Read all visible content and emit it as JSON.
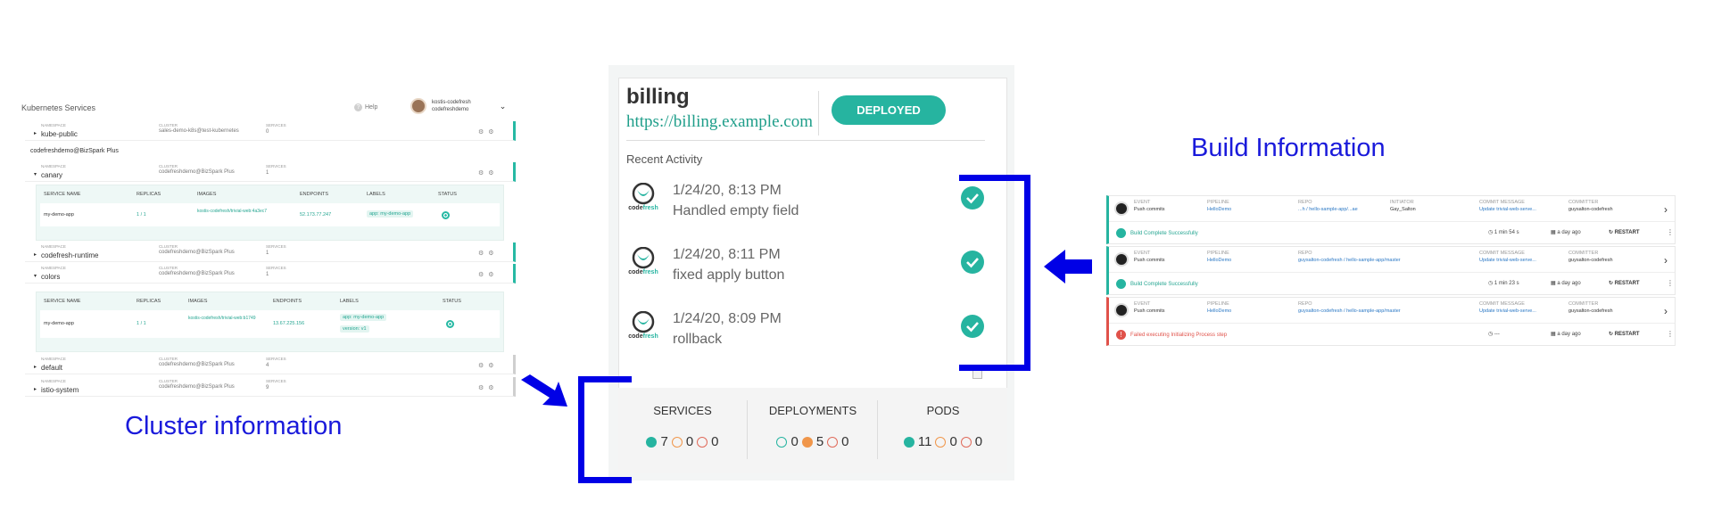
{
  "k8s": {
    "title": "Kubernetes Services",
    "help": "Help",
    "user_name": "kostis-codefresh",
    "user_account": "codefreshdemo",
    "cap_namespace": "NAMESPACE",
    "cap_cluster": "CLUSTER",
    "cap_services": "SERVICES",
    "rows": [
      {
        "ns": "kube-public",
        "cluster": "sales-demo-k8s@test-kubernetes",
        "services": "0"
      },
      {
        "ns": "canary",
        "cluster": "codefreshdemo@BizSpark Plus",
        "services": "1"
      },
      {
        "ns": "codefresh-runtime",
        "cluster": "codefreshdemo@BizSpark Plus",
        "services": "1"
      },
      {
        "ns": "colors",
        "cluster": "codefreshdemo@BizSpark Plus",
        "services": "1"
      },
      {
        "ns": "default",
        "cluster": "codefreshdemo@BizSpark Plus",
        "services": "4"
      },
      {
        "ns": "istio-system",
        "cluster": "codefreshdemo@BizSpark Plus",
        "services": "9"
      }
    ],
    "group_label": "codefreshdemo@BizSpark Plus",
    "table_headers": [
      "SERVICE NAME",
      "REPLICAS",
      "IMAGES",
      "ENDPOINTS",
      "LABELS",
      "STATUS"
    ],
    "sub1": {
      "name": "my-demo-app",
      "replicas": "1 / 1",
      "image": "kostis-codefresh/trivial-web:4a3ec7",
      "endpoint": "52.173.77.247",
      "label": "app: my-demo-app"
    },
    "sub2": {
      "name": "my-demo-app",
      "replicas": "1 / 1",
      "image": "kostis-codefresh/trivial-web:b1749",
      "endpoint": "13.67.225.156",
      "label1": "app: my-demo-app",
      "label2": "version: v1"
    }
  },
  "card": {
    "app_name": "billing",
    "url": "https://billing.example.com",
    "status_button": "DEPLOYED",
    "recent_title": "Recent Activity",
    "logo_text_a": "code",
    "logo_text_b": "fresh",
    "activities": [
      {
        "time": "1/24/20, 8:13 PM",
        "message": "Handled empty field"
      },
      {
        "time": "1/24/20, 8:11 PM",
        "message": "fixed apply button"
      },
      {
        "time": "1/24/20, 8:09 PM",
        "message": "rollback"
      }
    ],
    "stats": [
      {
        "title": "SERVICES",
        "values": [
          "7",
          "0",
          "0"
        ],
        "dots": [
          "f-teal",
          "o-orange",
          "o-red"
        ]
      },
      {
        "title": "DEPLOYMENTS",
        "values": [
          "0",
          "5",
          "0"
        ],
        "dots": [
          "o-teal",
          "f-orange",
          "o-red"
        ]
      },
      {
        "title": "PODS",
        "values": [
          "11",
          "0",
          "0"
        ],
        "dots": [
          "f-teal",
          "o-orange",
          "o-red"
        ]
      }
    ]
  },
  "captions": {
    "cluster": "Cluster information",
    "build": "Build Information"
  },
  "builds": {
    "labels": {
      "event": "EVENT",
      "pipeline": "PIPELINE",
      "repo": "REPO",
      "initiator": "INITIATOR",
      "commit": "COMMIT MESSAGE",
      "committer": "COMMITTER"
    },
    "items": [
      {
        "event": "Push commits",
        "pipeline": "HelloDemo",
        "repo": "...h / hello-sample-app/...ae",
        "initiator": "Gay_Salton",
        "commit": "Update trivial-web-serve...",
        "committer": "guysalton-codefresh",
        "status": "Build Complete Successfully",
        "duration": "1 min 54 s",
        "when": "a day ago",
        "restart": "RESTART",
        "state": "ok"
      },
      {
        "event": "Push commits",
        "pipeline": "HelloDemo",
        "repo": "guysalton-codefresh / hello-sample-app/master",
        "initiator": "",
        "commit": "Update trivial-web-serve...",
        "committer": "guysalton-codefresh",
        "status": "Build Complete Successfully",
        "duration": "1 min 23 s",
        "when": "a day ago",
        "restart": "RESTART",
        "state": "ok"
      },
      {
        "event": "Push commits",
        "pipeline": "HelloDemo",
        "repo": "guysalton-codefresh / hello-sample-app/master",
        "initiator": "",
        "commit": "Update trivial-web-serve...",
        "committer": "guysalton-codefresh",
        "status": "Failed executing Initializing Process step",
        "duration": "---",
        "when": "a day ago",
        "restart": "RESTART",
        "state": "failed"
      }
    ]
  },
  "colors": {
    "accent": "#26b4a0",
    "annotation": "#0000e6",
    "link": "#2b78c5",
    "error": "#e0524a",
    "warning": "#f0964a"
  }
}
